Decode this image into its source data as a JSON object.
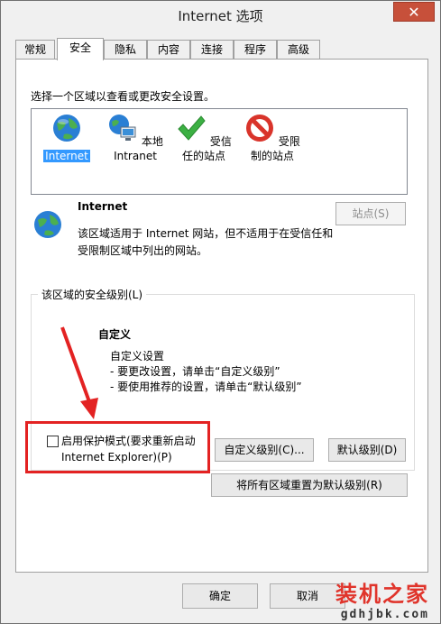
{
  "window": {
    "title": "Internet 选项",
    "close_glyph": "✕"
  },
  "tabs": [
    {
      "label": "常规"
    },
    {
      "label": "安全",
      "active": true
    },
    {
      "label": "隐私"
    },
    {
      "label": "内容"
    },
    {
      "label": "连接"
    },
    {
      "label": "程序"
    },
    {
      "label": "高级"
    }
  ],
  "zones": {
    "prompt": "选择一个区域以查看或更改安全设置。",
    "items": [
      {
        "icon": "globe-icon",
        "label": "Internet",
        "selected": true
      },
      {
        "icon": "intranet-icon",
        "label": "本地 Intranet"
      },
      {
        "icon": "checkmark-icon",
        "label": "受信任的站点"
      },
      {
        "icon": "no-entry-icon",
        "label": "受限制的站点"
      }
    ]
  },
  "zone_info": {
    "name": "Internet",
    "description": "该区域适用于 Internet 网站，但不适用于在受信任和受限制区域中列出的网站。",
    "sites_button": "站点(S)"
  },
  "security_level": {
    "group_label": "该区域的安全级别(L)",
    "title": "自定义",
    "lines": [
      "自定义设置",
      "- 要更改设置，请单击“自定义级别”",
      "- 要使用推荐的设置，请单击“默认级别”"
    ],
    "protected_mode": "启用保护模式(要求重新启动 Internet Explorer)(P)",
    "custom_level_button": "自定义级别(C)...",
    "default_level_button": "默认级别(D)",
    "reset_all_button": "将所有区域重置为默认级别(R)"
  },
  "footer": {
    "ok": "确定",
    "cancel": "取消"
  },
  "watermark": {
    "top": "装机之家",
    "bottom": "gdhjbk.com"
  },
  "colors": {
    "selection": "#3399ff",
    "close": "#c7503a",
    "annotation": "#e32222",
    "watermark": "#e0342b"
  }
}
